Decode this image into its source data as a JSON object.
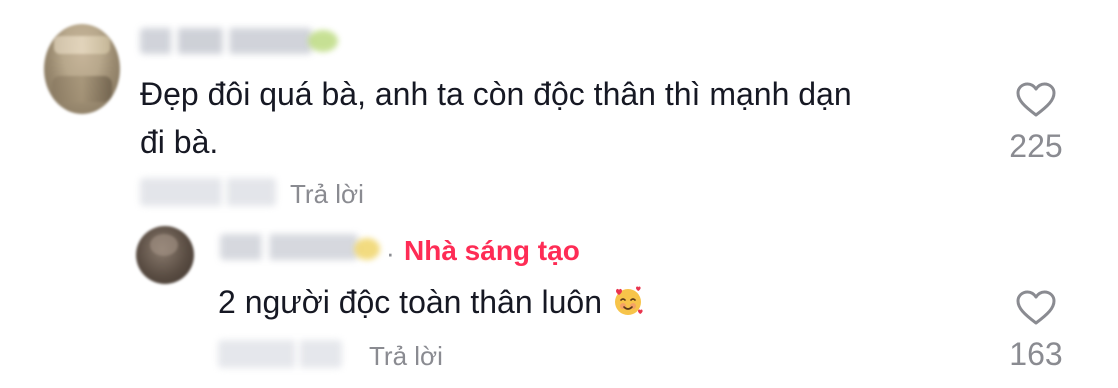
{
  "comments": [
    {
      "text_line1": "Đẹp đôi quá bà, anh ta còn độc thân thì mạnh dạn",
      "text_line2": "đi bà.",
      "reply_label": "Trả lời",
      "like_count": "225",
      "like_icon": "heart-outline-icon"
    },
    {
      "creator_separator": "·",
      "creator_tag": "Nhà sáng tạo",
      "text": "2 người độc toàn thân luôn",
      "emoji": "smiling-face-with-hearts",
      "reply_label": "Trả lời",
      "like_count": "163",
      "like_icon": "heart-outline-icon"
    }
  ],
  "colors": {
    "creator_tag": "#fe2c55",
    "secondary_text": "#8a8b91",
    "primary_text": "#161823"
  }
}
